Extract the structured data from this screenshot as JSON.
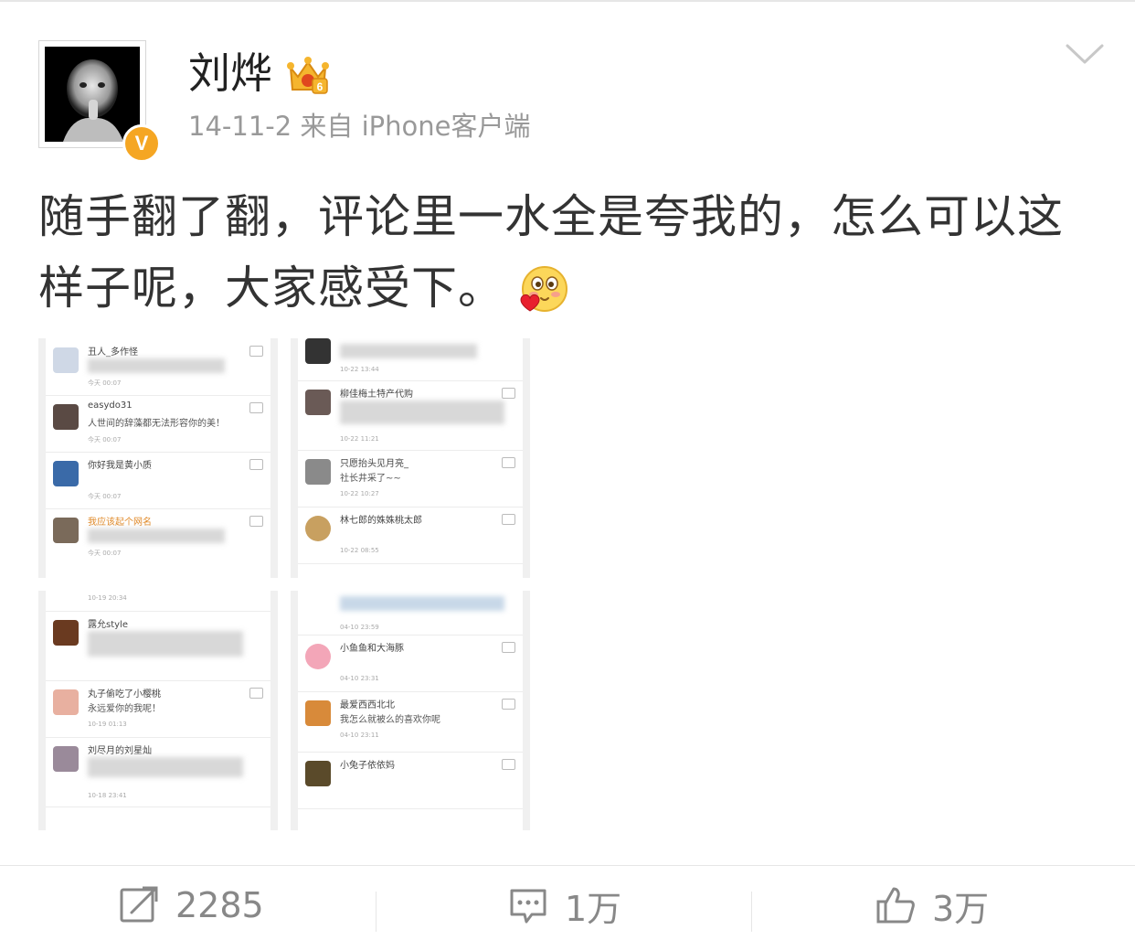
{
  "header": {
    "user_name": "刘烨",
    "verified_badge": "V",
    "meta_text": "14-11-2  来自 iPhone客户端",
    "crown_icon": "vip-crown-icon",
    "menu_icon": "chevron-down-icon"
  },
  "post": {
    "text": "随手翻了翻，评论里一水全是夸我的，怎么可以这样子呢，大家感受下。",
    "emoji": "blush-heart-emoji"
  },
  "images": [
    {
      "rows": [
        {
          "name": "丑人_多作怪",
          "text": "",
          "time": "今天 00:07"
        },
        {
          "name": "easydo31",
          "text": "人世间的辞藻都无法形容你的美！",
          "time": "今天 00:07"
        },
        {
          "name": "你好我是黄小质",
          "text": "",
          "time": "今天 00:07"
        },
        {
          "name": "我应该起个网名",
          "text": "",
          "time": "今天 00:07"
        }
      ]
    },
    {
      "rows": [
        {
          "name": "",
          "text": "",
          "time": "10-22 13:44"
        },
        {
          "name": "柳佳梅土特产代购",
          "text": "",
          "time": "10-22 11:21"
        },
        {
          "name": "只愿抬头见月亮_",
          "text": "社长井采了~~",
          "time": "10-22 10:27"
        },
        {
          "name": "林七郎的姝姝桃太郎",
          "text": "",
          "time": "10-22 08:55"
        }
      ]
    },
    {
      "rows": [
        {
          "name": "",
          "text": "",
          "time": "10-19 20:34"
        },
        {
          "name": "露允style",
          "text": "",
          "time": ""
        },
        {
          "name": "丸子偷吃了小樱桃",
          "text": "永远爱你的我呢！",
          "time": "10-19 01:13"
        },
        {
          "name": "刘尽月的刘星灿",
          "text": "",
          "time": "10-18 23:41"
        }
      ]
    },
    {
      "rows": [
        {
          "name": "",
          "text": "",
          "time": "04-10 23:59"
        },
        {
          "name": "小鱼鱼和大海豚",
          "text": "",
          "time": "04-10 23:31"
        },
        {
          "name": "最爱西西北北",
          "text": "我怎么就被么的喜欢你呢",
          "time": "04-10 23:11"
        },
        {
          "name": "小兔子依依妈",
          "text": "",
          "time": ""
        }
      ]
    }
  ],
  "footer": {
    "repost_count": "2285",
    "comment_count": "1万",
    "like_count": "3万",
    "repost_icon": "repost-icon",
    "comment_icon": "comment-icon",
    "like_icon": "thumbs-up-icon"
  }
}
